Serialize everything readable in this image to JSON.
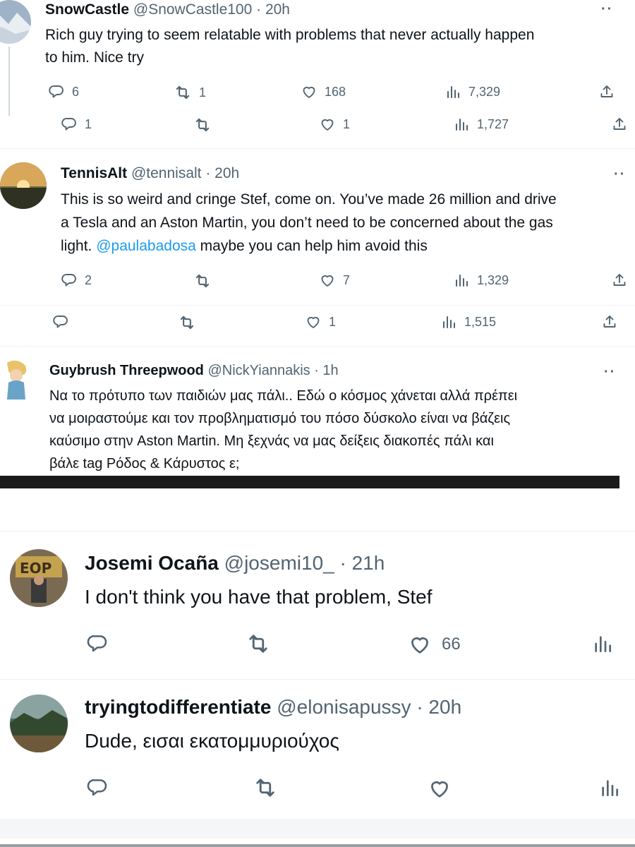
{
  "tweets": {
    "t1": {
      "name": "SnowCastle",
      "handle_time": "@SnowCastle100 · 20h",
      "text_line1": "Rich guy trying to seem relatable with problems that never actually happen",
      "text_line2": "to him. Nice try",
      "replies": "6",
      "retweets": "1",
      "likes": "168",
      "views": "7,329"
    },
    "t1b": {
      "replies": "1",
      "likes": "1",
      "views": "1,727"
    },
    "t2": {
      "name": "TennisAlt",
      "handle_time": "@tennisalt · 20h",
      "text_line1": "This is so weird and cringe Stef, come on. You’ve made 26 million and drive",
      "text_line2": "a Tesla and an Aston Martin, you don’t need to be concerned about the gas",
      "text_line3_pre": "light. ",
      "mention": "@paulabadosa",
      "text_line3_post": " maybe you can help him avoid this",
      "replies": "2",
      "likes": "7",
      "views": "1,329"
    },
    "t2b": {
      "likes": "1",
      "views": "1,515"
    },
    "t3": {
      "name": "Guybrush Threepwood",
      "handle_time": "@NickYiannakis · 1h",
      "text_line1": "Να το πρότυπο των παιδιών μας πάλι.. Εδώ ο κόσμος χάνεται αλλά πρέπει",
      "text_line2": "να μοιραστούμε και τον προβληματισμό του πόσο δύσκολο είναι να βάζεις",
      "text_line3": "καύσιμο στην Aston Martin. Μη ξεχνάς να μας δείξεις διακοπές πάλι και",
      "text_line4": "βάλε tag Ρόδος & Κάρυστος ε;"
    },
    "t4": {
      "name": "Josemi Ocaña",
      "handle_time": "@josemi10_ · 21h",
      "text": "I don't think you have that problem, Stef",
      "likes": "66"
    },
    "t5": {
      "name": "tryingtodifferentiate",
      "handle_time": "@elonisapussy · 20h",
      "text": "Dude, εισαι εκατομμυριούχος"
    }
  },
  "ui": {
    "more": "··",
    "colors": {
      "text": "#0f1419",
      "secondary": "#536471",
      "mention": "#1d9bf0",
      "divider": "#eff3f4",
      "dark_band": "#1a1a1a"
    }
  }
}
